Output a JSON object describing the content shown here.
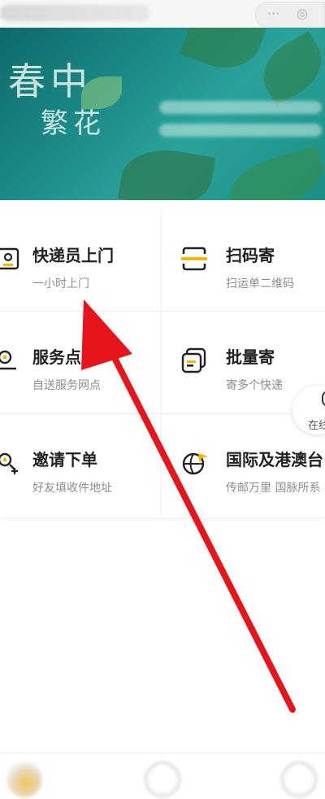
{
  "topbar": {
    "search_icon": "search-icon",
    "close_icon": "close-icon"
  },
  "banner": {
    "calligraphy": "春中",
    "calligraphy2": "繁花"
  },
  "services": [
    {
      "title": "快递员上门",
      "subtitle": "一小时上门",
      "icon": "courier-icon"
    },
    {
      "title": "扫码寄",
      "subtitle": "扫运单二维码",
      "icon": "scan-icon"
    },
    {
      "title": "服务点自",
      "subtitle": "自送服务网点",
      "icon": "location-icon"
    },
    {
      "title": "批量寄",
      "subtitle": "寄多个快递",
      "icon": "batch-icon"
    },
    {
      "title": "邀请下单",
      "subtitle": "好友填收件地址",
      "icon": "invite-icon"
    },
    {
      "title": "国际及港澳台",
      "subtitle": "传邮万里 国脉所系",
      "icon": "globe-plane-icon"
    }
  ],
  "floating": {
    "label": "在线"
  },
  "colors": {
    "accent": "#f5b800",
    "arrow": "#e8141b",
    "banner": "#1c8a87"
  }
}
